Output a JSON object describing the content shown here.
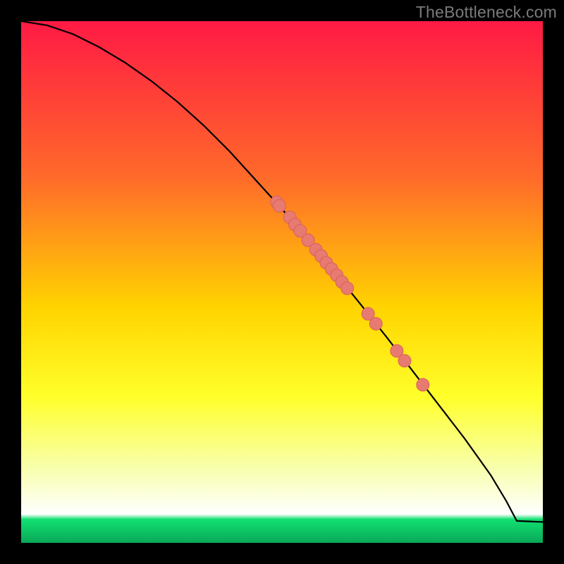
{
  "watermark": "TheBottleneck.com",
  "colors": {
    "line": "#000000",
    "marker_fill": "#e77a71",
    "marker_stroke": "#da6059",
    "frame": "#000000",
    "grad_top": "#ff1a44",
    "grad_mid1": "#ff6a2a",
    "grad_mid2": "#ffd400",
    "grad_mid3": "#ffff2a",
    "grad_mid4": "#f8ffb0",
    "grad_green": "#10e070"
  },
  "chart_data": {
    "type": "line",
    "title": "",
    "xlabel": "",
    "ylabel": "",
    "xlim": [
      0,
      100
    ],
    "ylim": [
      0,
      100
    ],
    "series": [
      {
        "name": "curve",
        "x": [
          0,
          5,
          10,
          15,
          20,
          25,
          30,
          35,
          40,
          45,
          50,
          55,
          60,
          65,
          70,
          75,
          80,
          85,
          90,
          93,
          95,
          100
        ],
        "y": [
          100,
          99.2,
          97.5,
          95.0,
          92.0,
          88.5,
          84.5,
          80.0,
          75.0,
          69.5,
          64.0,
          58.0,
          52.0,
          45.8,
          39.5,
          33.0,
          26.5,
          20.0,
          13.0,
          8.0,
          4.2,
          4.0
        ]
      }
    ],
    "markers": {
      "name": "points",
      "x": [
        49.0,
        49.5,
        51.5,
        52.5,
        53.5,
        55.0,
        56.5,
        57.5,
        58.5,
        59.5,
        60.5,
        61.5,
        62.5,
        66.5,
        68.0,
        72.0,
        73.5,
        77.0
      ],
      "y": [
        65.3,
        64.6,
        62.4,
        61.0,
        59.8,
        58.0,
        56.2,
        55.0,
        53.7,
        52.5,
        51.3,
        50.0,
        48.8,
        43.9,
        42.0,
        36.8,
        34.9,
        30.3
      ]
    }
  }
}
